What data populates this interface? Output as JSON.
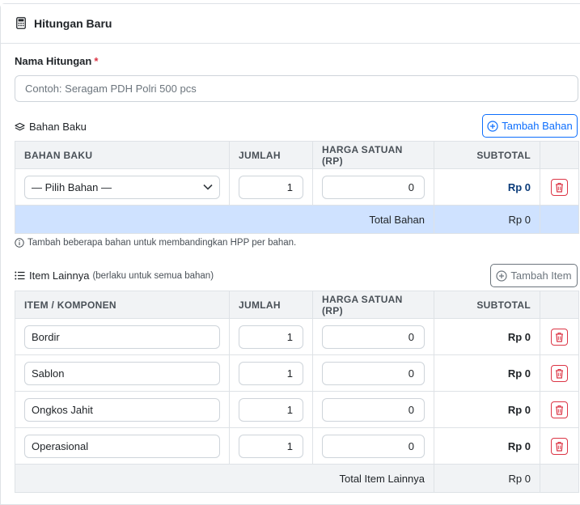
{
  "header": {
    "title": "Hitungan Baru",
    "icon": "calculator-icon"
  },
  "form": {
    "nama_label": "Nama Hitungan",
    "required_mark": "*",
    "nama_placeholder": "Contoh: Seragam PDH Polri 500 pcs",
    "nama_value": ""
  },
  "bahan": {
    "section_title": "Bahan Baku",
    "section_icon": "layers-icon",
    "add_button": "Tambah Bahan",
    "columns": [
      "BAHAN BAKU",
      "JUMLAH",
      "HARGA SATUAN (RP)",
      "SUBTOTAL"
    ],
    "rows": [
      {
        "select": "— Pilih Bahan —",
        "jumlah": "1",
        "harga": "0",
        "subtotal": "Rp 0"
      }
    ],
    "total_label": "Total Bahan",
    "total_value": "Rp 0",
    "hint": "Tambah beberapa bahan untuk membandingkan HPP per bahan."
  },
  "items": {
    "section_title": "Item Lainnya",
    "section_note": "(berlaku untuk semua bahan)",
    "section_icon": "list-icon",
    "add_button": "Tambah Item",
    "columns": [
      "ITEM / KOMPONEN",
      "JUMLAH",
      "HARGA SATUAN (RP)",
      "SUBTOTAL"
    ],
    "rows": [
      {
        "name": "Bordir",
        "jumlah": "1",
        "harga": "0",
        "subtotal": "Rp 0"
      },
      {
        "name": "Sablon",
        "jumlah": "1",
        "harga": "0",
        "subtotal": "Rp 0"
      },
      {
        "name": "Ongkos Jahit",
        "jumlah": "1",
        "harga": "0",
        "subtotal": "Rp 0"
      },
      {
        "name": "Operasional",
        "jumlah": "1",
        "harga": "0",
        "subtotal": "Rp 0"
      }
    ],
    "total_label": "Total Item Lainnya",
    "total_value": "Rp 0"
  },
  "colors": {
    "primary": "#0d6efd",
    "danger": "#dc3545",
    "total_bahan_bg": "#cfe2ff",
    "header_bg": "#f1f3f5"
  }
}
